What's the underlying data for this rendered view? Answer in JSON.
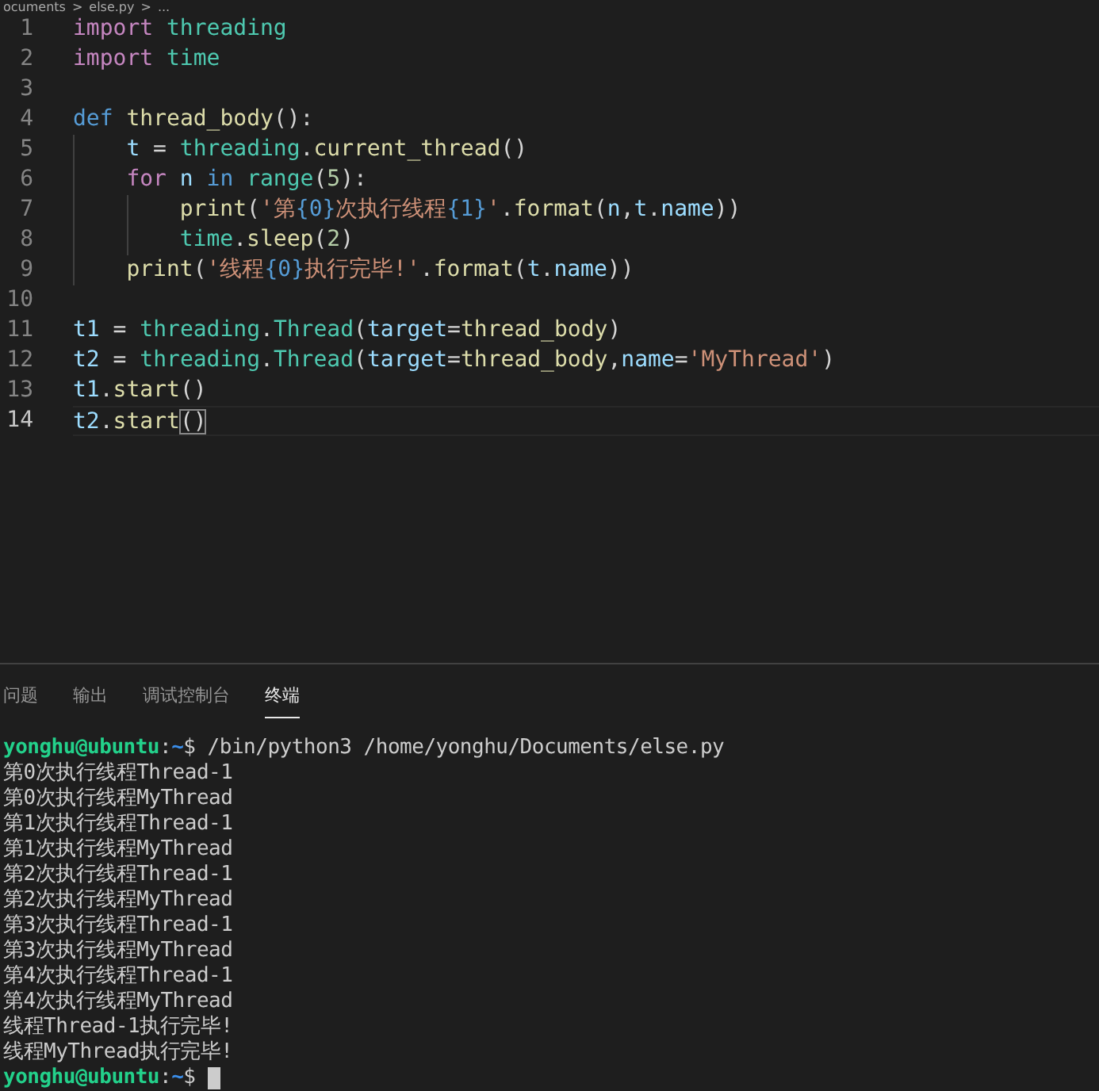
{
  "breadcrumb": [
    "ocuments",
    ">",
    "else.py",
    ">",
    "..."
  ],
  "editor": {
    "lines": [
      {
        "number": "1",
        "current": false,
        "tokens": [
          {
            "kind": "kw",
            "t": "import"
          },
          {
            "kind": "mod",
            "t": " threading"
          }
        ]
      },
      {
        "number": "2",
        "current": false,
        "tokens": [
          {
            "kind": "kw",
            "t": "import"
          },
          {
            "kind": "mod",
            "t": " time"
          }
        ]
      },
      {
        "number": "3",
        "current": false
      },
      {
        "number": "4",
        "current": false,
        "tokens": [
          {
            "kind": "def",
            "t": "def"
          },
          {
            "kind": "fn",
            "t": " thread_body"
          },
          {
            "kind": "pl",
            "t": "():"
          }
        ],
        "children": [
          {
            "number": "5",
            "current": false,
            "tokens": [
              {
                "kind": "var",
                "t": "t"
              },
              {
                "kind": "pl",
                "t": " = "
              },
              {
                "kind": "mod",
                "t": "threading"
              },
              {
                "kind": "pl",
                "t": "."
              },
              {
                "kind": "fn",
                "t": "current_thread"
              },
              {
                "kind": "pl",
                "t": "()"
              }
            ]
          },
          {
            "number": "6",
            "current": false,
            "tokens": [
              {
                "kind": "kw",
                "t": "for"
              },
              {
                "kind": "var",
                "t": " n"
              },
              {
                "kind": "def",
                "t": " in"
              },
              {
                "kind": "mod",
                "t": " range"
              },
              {
                "kind": "pl",
                "t": "("
              },
              {
                "kind": "num",
                "t": "5"
              },
              {
                "kind": "pl",
                "t": "):"
              }
            ],
            "children": [
              {
                "number": "7",
                "current": false,
                "tokens": [
                  {
                    "kind": "fn",
                    "t": "print"
                  },
                  {
                    "kind": "pl",
                    "t": "("
                  },
                  {
                    "kind": "str",
                    "t": "'第"
                  },
                  {
                    "kind": "def",
                    "t": "{0}"
                  },
                  {
                    "kind": "str",
                    "t": "次执行线程"
                  },
                  {
                    "kind": "def",
                    "t": "{1}"
                  },
                  {
                    "kind": "str",
                    "t": "'"
                  },
                  {
                    "kind": "pl",
                    "t": "."
                  },
                  {
                    "kind": "fn",
                    "t": "format"
                  },
                  {
                    "kind": "pl",
                    "t": "("
                  },
                  {
                    "kind": "var",
                    "t": "n"
                  },
                  {
                    "kind": "pl",
                    "t": ","
                  },
                  {
                    "kind": "var",
                    "t": "t"
                  },
                  {
                    "kind": "pl",
                    "t": "."
                  },
                  {
                    "kind": "var",
                    "t": "name"
                  },
                  {
                    "kind": "pl",
                    "t": "))"
                  }
                ]
              },
              {
                "number": "8",
                "current": false,
                "tokens": [
                  {
                    "kind": "mod",
                    "t": "time"
                  },
                  {
                    "kind": "pl",
                    "t": "."
                  },
                  {
                    "kind": "fn",
                    "t": "sleep"
                  },
                  {
                    "kind": "pl",
                    "t": "("
                  },
                  {
                    "kind": "num",
                    "t": "2"
                  },
                  {
                    "kind": "pl",
                    "t": ")"
                  }
                ]
              }
            ]
          },
          {
            "number": "9",
            "current": false,
            "tokens": [
              {
                "kind": "fn",
                "t": "print"
              },
              {
                "kind": "pl",
                "t": "("
              },
              {
                "kind": "str",
                "t": "'线程"
              },
              {
                "kind": "def",
                "t": "{0}"
              },
              {
                "kind": "str",
                "t": "执行完毕!'"
              },
              {
                "kind": "pl",
                "t": "."
              },
              {
                "kind": "fn",
                "t": "format"
              },
              {
                "kind": "pl",
                "t": "("
              },
              {
                "kind": "var",
                "t": "t"
              },
              {
                "kind": "pl",
                "t": "."
              },
              {
                "kind": "var",
                "t": "name"
              },
              {
                "kind": "pl",
                "t": "))"
              }
            ]
          }
        ]
      },
      {
        "number": "10",
        "current": false
      },
      {
        "number": "11",
        "current": false,
        "tokens": [
          {
            "kind": "var",
            "t": "t1"
          },
          {
            "kind": "pl",
            "t": " = "
          },
          {
            "kind": "mod",
            "t": "threading"
          },
          {
            "kind": "pl",
            "t": "."
          },
          {
            "kind": "mod",
            "t": "Thread"
          },
          {
            "kind": "pl",
            "t": "("
          },
          {
            "kind": "var",
            "t": "target"
          },
          {
            "kind": "pl",
            "t": "="
          },
          {
            "kind": "fn",
            "t": "thread_body"
          },
          {
            "kind": "pl",
            "t": ")"
          }
        ]
      },
      {
        "number": "12",
        "current": false,
        "tokens": [
          {
            "kind": "var",
            "t": "t2"
          },
          {
            "kind": "pl",
            "t": " = "
          },
          {
            "kind": "mod",
            "t": "threading"
          },
          {
            "kind": "pl",
            "t": "."
          },
          {
            "kind": "mod",
            "t": "Thread"
          },
          {
            "kind": "pl",
            "t": "("
          },
          {
            "kind": "var",
            "t": "target"
          },
          {
            "kind": "pl",
            "t": "="
          },
          {
            "kind": "fn",
            "t": "thread_body"
          },
          {
            "kind": "pl",
            "t": ","
          },
          {
            "kind": "var",
            "t": "name"
          },
          {
            "kind": "pl",
            "t": "="
          },
          {
            "kind": "str",
            "t": "'MyThread'"
          },
          {
            "kind": "pl",
            "t": ")"
          }
        ]
      },
      {
        "number": "13",
        "current": false,
        "tokens": [
          {
            "kind": "var",
            "t": "t1"
          },
          {
            "kind": "pl",
            "t": "."
          },
          {
            "kind": "fn",
            "t": "start"
          },
          {
            "kind": "pl",
            "t": "()"
          }
        ]
      },
      {
        "number": "14",
        "current": true,
        "tokens": [
          {
            "kind": "var",
            "t": "t2"
          },
          {
            "kind": "pl",
            "t": "."
          },
          {
            "kind": "fn",
            "t": "start"
          },
          {
            "kind": "match",
            "t": "()"
          }
        ]
      }
    ]
  },
  "panel_tabs": [
    {
      "label": "问题",
      "selected": false
    },
    {
      "label": "输出",
      "selected": false
    },
    {
      "label": "调试控制台",
      "selected": false
    },
    {
      "label": "终端",
      "selected": true
    }
  ],
  "terminal": {
    "command_prompt": {
      "user": "yonghu@ubuntu",
      "sep": ":",
      "path": "~",
      "command": "$ /bin/python3 /home/yonghu/Documents/else.py"
    },
    "output": [
      "第0次执行线程Thread-1",
      "第0次执行线程MyThread",
      "第1次执行线程Thread-1",
      "第1次执行线程MyThread",
      "第2次执行线程Thread-1",
      "第2次执行线程MyThread",
      "第3次执行线程Thread-1",
      "第3次执行线程MyThread",
      "第4次执行线程Thread-1",
      "第4次执行线程MyThread",
      "线程Thread-1执行完毕!",
      "线程MyThread执行完毕!"
    ],
    "last_prompt": {
      "user": "yonghu@ubuntu",
      "sep": ":",
      "path": "~",
      "command": "$"
    }
  }
}
